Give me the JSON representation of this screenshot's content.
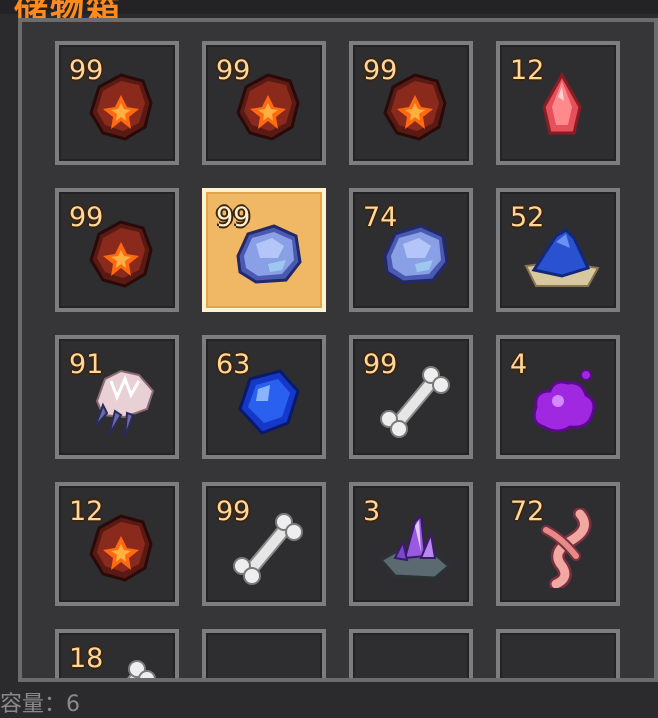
{
  "title": "储物箱",
  "footer": "容量：6",
  "slots": [
    {
      "count": "99",
      "icon": "fire-ore-icon"
    },
    {
      "count": "99",
      "icon": "fire-ore-icon"
    },
    {
      "count": "99",
      "icon": "fire-ore-icon"
    },
    {
      "count": "12",
      "icon": "red-crystal-shard-icon"
    },
    {
      "count": "99",
      "icon": "fire-ore-icon"
    },
    {
      "count": "99",
      "icon": "blue-stone-icon",
      "selected": true
    },
    {
      "count": "74",
      "icon": "blue-stone-icon"
    },
    {
      "count": "52",
      "icon": "blue-dye-pile-icon"
    },
    {
      "count": "91",
      "icon": "beast-claw-icon"
    },
    {
      "count": "63",
      "icon": "sapphire-gem-icon"
    },
    {
      "count": "99",
      "icon": "bone-icon"
    },
    {
      "count": "4",
      "icon": "purple-slime-icon"
    },
    {
      "count": "12",
      "icon": "fire-ore-icon"
    },
    {
      "count": "99",
      "icon": "bone-icon"
    },
    {
      "count": "3",
      "icon": "purple-crystal-ore-icon"
    },
    {
      "count": "72",
      "icon": "twisted-root-icon"
    },
    {
      "count": "18",
      "icon": "bone-icon"
    },
    {
      "count": "",
      "icon": ""
    },
    {
      "count": "",
      "icon": ""
    },
    {
      "count": "",
      "icon": ""
    }
  ],
  "colors": {
    "accent_title": "#ff8a1e",
    "selected_slot": "#f0b764",
    "count_text": "#ffd79a"
  }
}
